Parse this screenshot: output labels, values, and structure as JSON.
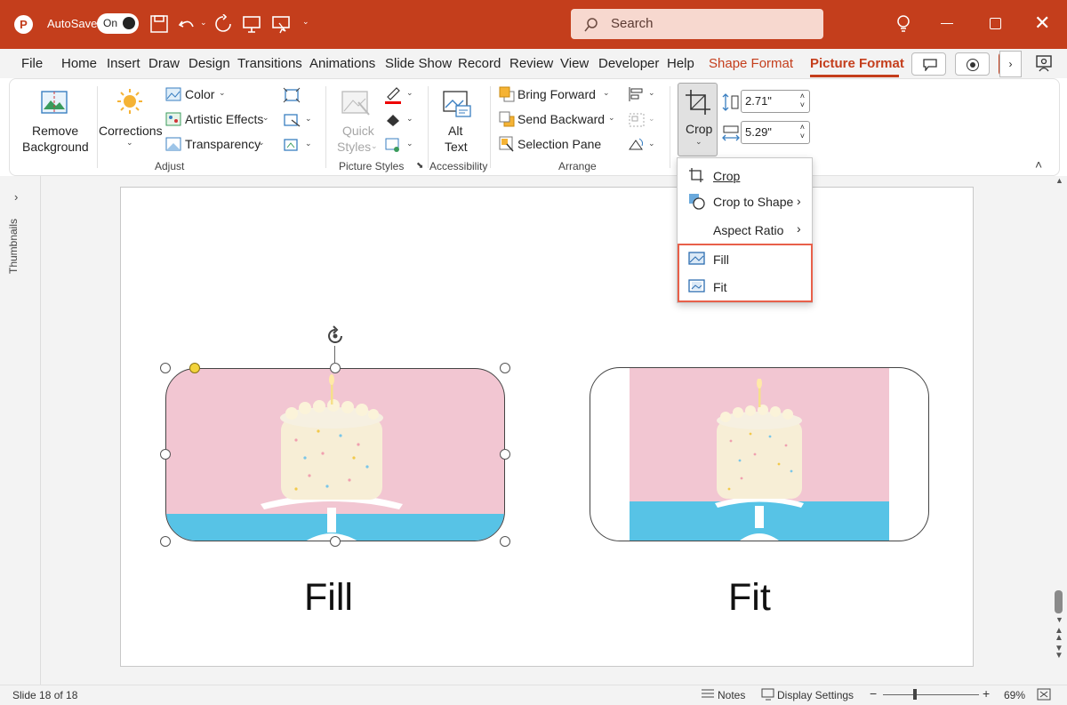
{
  "titlebar": {
    "autosave_label": "AutoSave",
    "toggle_label": "On",
    "search_placeholder": "Search"
  },
  "tabs": [
    "File",
    "Home",
    "Insert",
    "Draw",
    "Design",
    "Transitions",
    "Animations",
    "Slide Show",
    "Record",
    "Review",
    "View",
    "Developer",
    "Help",
    "Shape Format",
    "Picture Format"
  ],
  "ribbon": {
    "remove_bg": [
      "Remove",
      "Background"
    ],
    "corrections": "Corrections",
    "color": "Color",
    "artistic": "Artistic Effects",
    "transparency": "Transparency",
    "quick_styles": [
      "Quick",
      "Styles"
    ],
    "alt_text": [
      "Alt",
      "Text"
    ],
    "bring_forward": "Bring Forward",
    "send_backward": "Send Backward",
    "selection_pane": "Selection Pane",
    "crop": "Crop",
    "height": "2.71\"",
    "width": "5.29\"",
    "groups": {
      "adjust": "Adjust",
      "picture_styles": "Picture Styles",
      "accessibility": "Accessibility",
      "arrange": "Arrange"
    }
  },
  "crop_menu": {
    "crop": "Crop",
    "crop_to_shape": "Crop to Shape",
    "aspect_ratio": "Aspect Ratio",
    "fill": "Fill",
    "fit": "Fit"
  },
  "thumbnails_label": "Thumbnails",
  "slide": {
    "left_caption": "Fill",
    "right_caption": "Fit"
  },
  "status": {
    "slide": "Slide 18 of 18",
    "notes": "Notes",
    "display": "Display Settings",
    "zoom": "69%"
  },
  "colors": {
    "accent": "#c43e1c",
    "highlight": "#e8604a",
    "pink": "#f2c6d2",
    "blue": "#57c3e6"
  }
}
